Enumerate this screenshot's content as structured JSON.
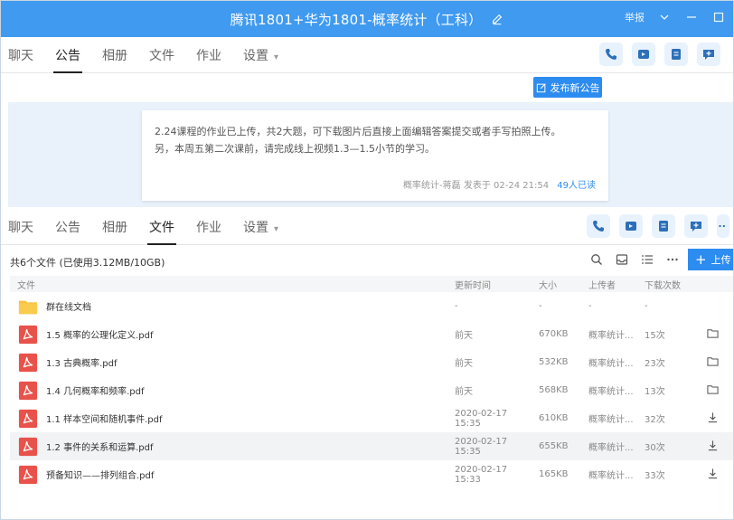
{
  "window": {
    "title": "腾讯1801+华为1801-概率统计（工科）",
    "report_label": "举报"
  },
  "tabs_top": [
    {
      "label": "聊天",
      "active": false
    },
    {
      "label": "公告",
      "active": true
    },
    {
      "label": "相册",
      "active": false
    },
    {
      "label": "文件",
      "active": false
    },
    {
      "label": "作业",
      "active": false
    },
    {
      "label": "设置",
      "active": false
    }
  ],
  "tabs_bottom": [
    {
      "label": "聊天",
      "active": false
    },
    {
      "label": "公告",
      "active": false
    },
    {
      "label": "相册",
      "active": false
    },
    {
      "label": "文件",
      "active": true
    },
    {
      "label": "作业",
      "active": false
    },
    {
      "label": "设置",
      "active": false
    }
  ],
  "announcement": {
    "publish_label": "发布新公告",
    "line1": "2.24课程的作业已上传，共2大题，可下载图片后直接上面编辑答案提交或者手写拍照上传。",
    "line2": "另，本周五第二次课前，请完成线上视频1.3—1.5小节的学习。",
    "author": "概率统计-蒋磊",
    "published": "发表于 02-24 21:54",
    "readers": "49人已读"
  },
  "files": {
    "summary": "共6个文件 (已使用3.12MB/10GB)",
    "upload_label": "上传",
    "columns": [
      "文件",
      "更新时间",
      "大小",
      "上传者",
      "下载次数"
    ],
    "rows": [
      {
        "name": "群在线文档",
        "time": "-",
        "size": "-",
        "uploader": "-",
        "downloads": "-",
        "type": "folder",
        "action": ""
      },
      {
        "name": "1.5 概率的公理化定义.pdf",
        "time": "前天",
        "size": "670KB",
        "uploader": "概率统计...",
        "downloads": "15次",
        "type": "pdf",
        "action": "folder"
      },
      {
        "name": "1.3 古典概率.pdf",
        "time": "前天",
        "size": "532KB",
        "uploader": "概率统计...",
        "downloads": "23次",
        "type": "pdf",
        "action": "folder"
      },
      {
        "name": "1.4 几何概率和频率.pdf",
        "time": "前天",
        "size": "568KB",
        "uploader": "概率统计...",
        "downloads": "13次",
        "type": "pdf",
        "action": "folder"
      },
      {
        "name": "1.1 样本空间和随机事件.pdf",
        "time": "2020-02-17 15:35",
        "size": "610KB",
        "uploader": "概率统计...",
        "downloads": "32次",
        "type": "pdf",
        "action": "download"
      },
      {
        "name": "1.2 事件的关系和运算.pdf",
        "time": "2020-02-17 15:35",
        "size": "655KB",
        "uploader": "概率统计...",
        "downloads": "30次",
        "type": "pdf",
        "action": "download"
      },
      {
        "name": "预备知识——排列组合.pdf",
        "time": "2020-02-17 15:33",
        "size": "165KB",
        "uploader": "概率统计...",
        "downloads": "33次",
        "type": "pdf",
        "action": "download"
      }
    ]
  },
  "colors": {
    "accent": "#2d8cf0",
    "titlebar": "#3f9af0",
    "pdf_red": "#e8524a",
    "folder_yellow": "#f7c23a"
  }
}
